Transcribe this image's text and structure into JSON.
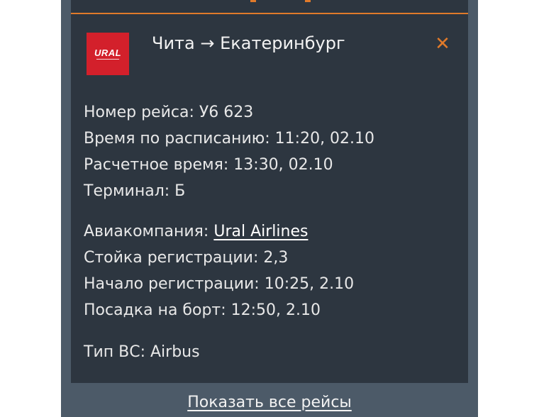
{
  "colors": {
    "page_background": "#ffffff",
    "panel_background": "#4c5a68",
    "card_background": "#2d3640",
    "accent": "#e07a2a",
    "airline_logo": "#d3202b",
    "text": "#e8e8e8"
  },
  "card": {
    "logo": {
      "icon": "ural-airlines-logo",
      "brand_text": "URAL"
    },
    "title": "Чита → Екатеринбург",
    "close_icon": "close-icon"
  },
  "flight": {
    "number_label": "Номер рейса:",
    "number": "У6 623",
    "scheduled_label": "Время по расписанию:",
    "scheduled": "11:20, 02.10",
    "estimated_label": "Расчетное время:",
    "estimated": "13:30, 02.10",
    "terminal_label": "Терминал:",
    "terminal": "Б",
    "airline_label": "Авиакомпания:",
    "airline": "Ural Airlines",
    "checkin_desk_label": "Стойка регистрации:",
    "checkin_desk": "2,3",
    "checkin_start_label": "Начало регистрации:",
    "checkin_start": "10:25, 2.10",
    "boarding_label": "Посадка на борт:",
    "boarding": "12:50, 2.10",
    "aircraft_label": "Тип ВС:",
    "aircraft": "Airbus"
  },
  "footer": {
    "show_all_label": "Показать все рейсы"
  }
}
